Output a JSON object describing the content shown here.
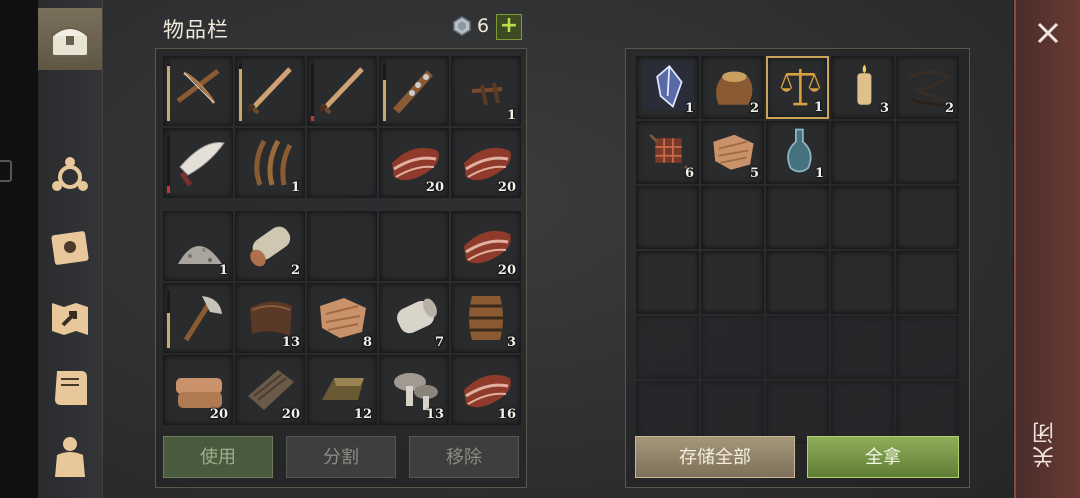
{
  "title": "物品栏",
  "currency": {
    "icon": "gem-icon",
    "count": "6",
    "add_label": "+"
  },
  "inventory": {
    "equipment": [
      {
        "name": "crossbow-icon",
        "qty": "",
        "dur": 0.95,
        "dur_color": "#c9a970"
      },
      {
        "name": "sword-icon",
        "qty": "",
        "dur": 0.9,
        "dur_color": "#c9a970"
      },
      {
        "name": "sword-icon",
        "qty": "",
        "dur": 0.08,
        "dur_color": "#c0392b"
      },
      {
        "name": "spiked-club-icon",
        "qty": "",
        "dur": 0.7,
        "dur_color": "#c9a970"
      },
      {
        "name": "nails-icon",
        "qty": "1"
      },
      {
        "name": "machete-icon",
        "qty": "",
        "dur": 0.12,
        "dur_color": "#c0392b"
      },
      {
        "name": "fiber-icon",
        "qty": "1"
      },
      {
        "name": "empty",
        "qty": ""
      },
      {
        "name": "raw-meat-icon",
        "qty": "20"
      },
      {
        "name": "raw-meat-icon",
        "qty": "20"
      }
    ],
    "backpack": [
      {
        "name": "stone-pile-icon",
        "qty": "1"
      },
      {
        "name": "log-icon",
        "qty": "2"
      },
      {
        "name": "empty",
        "qty": ""
      },
      {
        "name": "empty",
        "qty": ""
      },
      {
        "name": "raw-meat-icon",
        "qty": "20"
      },
      {
        "name": "axe-icon",
        "qty": "",
        "dur": 0.6,
        "dur_color": "#c9a970"
      },
      {
        "name": "leather-icon",
        "qty": "13"
      },
      {
        "name": "cloth-scrap-icon",
        "qty": "8"
      },
      {
        "name": "cloth-roll-icon",
        "qty": "7"
      },
      {
        "name": "barrel-icon",
        "qty": "3"
      },
      {
        "name": "folded-cloth-icon",
        "qty": "20"
      },
      {
        "name": "plank-icon",
        "qty": "20"
      },
      {
        "name": "ingot-icon",
        "qty": "12"
      },
      {
        "name": "mushroom-icon",
        "qty": "13"
      },
      {
        "name": "raw-meat-icon",
        "qty": "16"
      }
    ]
  },
  "loot": [
    {
      "name": "crystal-icon",
      "qty": "1"
    },
    {
      "name": "sack-icon",
      "qty": "2"
    },
    {
      "name": "scales-icon",
      "qty": "1",
      "highlight": true
    },
    {
      "name": "candle-icon",
      "qty": "3"
    },
    {
      "name": "rope-icon",
      "qty": "2"
    },
    {
      "name": "scrap-icon",
      "qty": "6"
    },
    {
      "name": "cloth-scrap-icon",
      "qty": "5"
    },
    {
      "name": "bottle-icon",
      "qty": "1"
    }
  ],
  "buttons": {
    "use": "使用",
    "split": "分割",
    "remove": "移除",
    "store_all": "存储全部",
    "take_all": "全拿"
  },
  "close_label": "关闭",
  "colors": {
    "accent_gold": "#c9a55a",
    "take_all_green": "#7a9a46",
    "close_red": "#6b3a34"
  }
}
